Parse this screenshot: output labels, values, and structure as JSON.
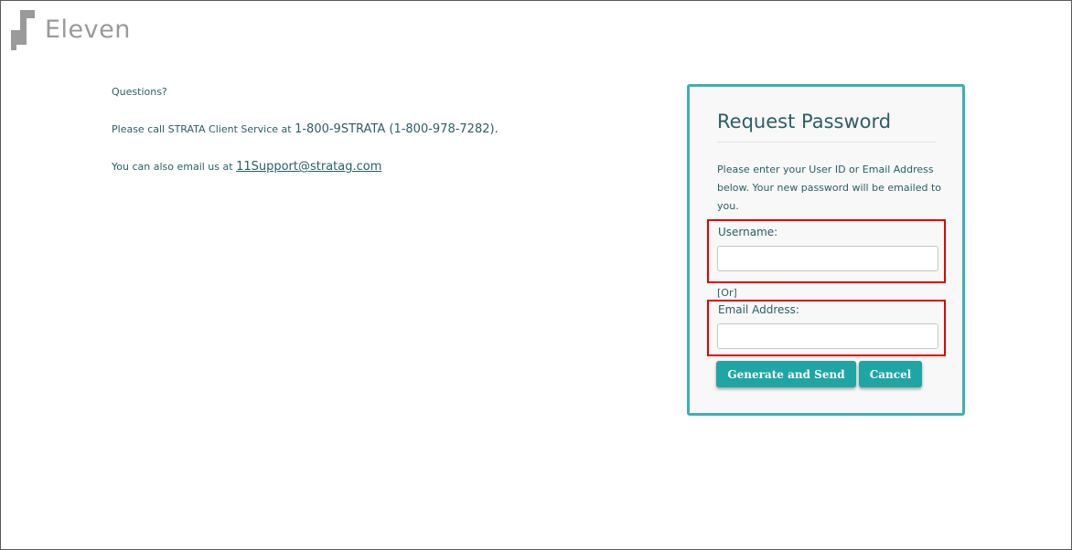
{
  "brand": {
    "name": "Eleven",
    "logo_color": "#9a9a9a"
  },
  "info": {
    "questions": "Questions?",
    "call_text": "Please call STRATA Client Service at ",
    "phone": "1-800-9STRATA (1-800-978-7282).",
    "email_text": "You can also email us at ",
    "email_link": "11Support@stratag.com"
  },
  "panel": {
    "title": "Request Password",
    "description": "Please enter your User ID or Email Address below. Your new password will be emailed to you.",
    "username_label": "Username:",
    "username_value": "",
    "or_text": "[Or]",
    "email_label": "Email Address:",
    "email_value": "",
    "generate_button": "Generate and Send",
    "cancel_button": "Cancel",
    "accent_color": "#3fb0b0",
    "highlight_color": "#e00000"
  }
}
